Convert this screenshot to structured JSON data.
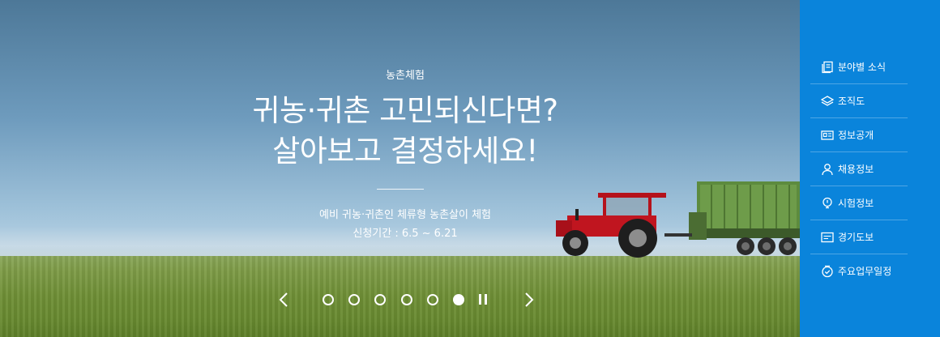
{
  "slide": {
    "category": "농촌체험",
    "title_line1": "귀농·귀촌 고민되신다면?",
    "title_line2": "살아보고 결정하세요!",
    "subtitle": "예비 귀농·귀촌인 체류형 농촌살이 체험",
    "period": "신청기간 : 6.5 ~ 6.21"
  },
  "slider": {
    "prev_icon": "chevron-left-icon",
    "next_icon": "chevron-right-icon",
    "pause_icon": "pause-icon",
    "total_slides": 6,
    "active_slide": 6
  },
  "quick_menu": {
    "background": "#0a84db",
    "items": [
      {
        "label": "분야별 소식",
        "icon": "news-icon"
      },
      {
        "label": "조직도",
        "icon": "layers-icon"
      },
      {
        "label": "정보공개",
        "icon": "info-card-icon"
      },
      {
        "label": "채용정보",
        "icon": "person-icon"
      },
      {
        "label": "시험정보",
        "icon": "bulb-icon"
      },
      {
        "label": "경기도보",
        "icon": "document-icon"
      },
      {
        "label": "주요업무일정",
        "icon": "clock-check-icon"
      }
    ]
  }
}
